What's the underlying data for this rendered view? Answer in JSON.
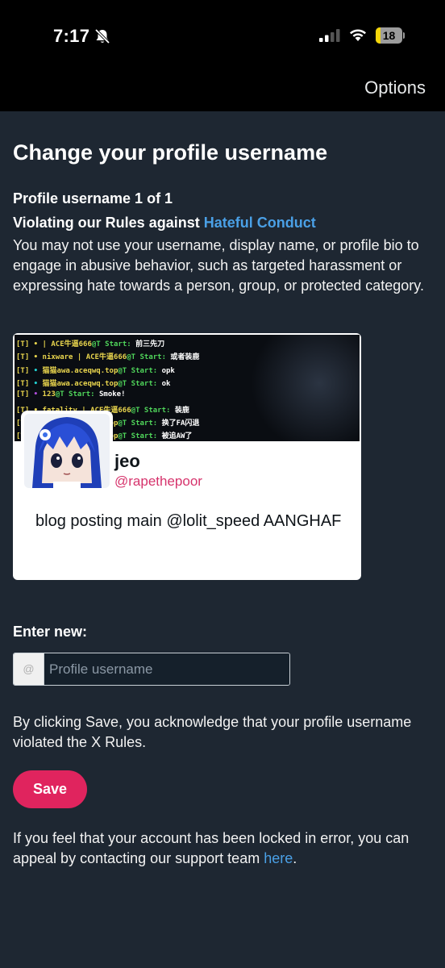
{
  "status_bar": {
    "time": "7:17",
    "battery_level": "18",
    "battery_fraction": 0.18,
    "icons": [
      "bell-slash-icon",
      "signal-icon",
      "wifi-icon",
      "battery-icon"
    ]
  },
  "nav": {
    "options_label": "Options"
  },
  "page": {
    "title": "Change your profile username",
    "subtitle": "Profile username 1 of 1",
    "violation_prefix": "Violating our Rules against",
    "violation_link": "Hateful Conduct",
    "description": "You may not use your username, display name, or profile bio to engage in abusive behavior, such as targeted harassment or expressing hate towards a person, group, or protected category."
  },
  "profile_card": {
    "banner_lines": [
      {
        "tag": "[T]",
        "dot": "•",
        "name": " | ACE牛逼666",
        "start": "@T Start:",
        "msg": " 前三先刀",
        "dot_color": "#e8d44d"
      },
      {
        "tag": "[T]",
        "dot": "•",
        "name": " nixware | ACE牛逼666",
        "start": "@T Start:",
        "msg": " 或者装鹿",
        "dot_color": "#e8d44d"
      },
      {
        "tag": "[T]",
        "dot": "•",
        "name": " 猫猫awa.aceqwq.top",
        "start": "@T Start:",
        "msg": " opk",
        "dot_color": "#22d3d3"
      },
      {
        "tag": "[T]",
        "dot": "•",
        "name": " 猫猫awa.aceqwq.top",
        "start": "@T Start:",
        "msg": " ok",
        "dot_color": "#22d3d3"
      },
      {
        "tag": "[T]",
        "dot": "•",
        "name": " 123",
        "start": "@T Start:",
        "msg": " Smoke!",
        "dot_color": "#b04ddb"
      },
      {
        "tag": "[T]",
        "dot": "•",
        "name": " fatality | ACE牛逼666",
        "start": "@T Start:",
        "msg": " 装鹿",
        "dot_color": "#e8d44d"
      },
      {
        "tag": "[T]",
        "dot": "•",
        "name": " 猫猫awa.aceqwq.top",
        "start": "@T Start:",
        "msg": " 换了FA闪退",
        "dot_color": "#22d3d3"
      },
      {
        "tag": "[T]",
        "dot": "•",
        "name": " 猫猫awa.aceqwq.top",
        "start": "@T Start:",
        "msg": " 被追AW了",
        "dot_color": "#22d3d3"
      }
    ],
    "display_name": "jeo",
    "handle": "@rapethepoor",
    "bio": "blog posting main @lolit_speed AANGHAF"
  },
  "form": {
    "enter_label": "Enter new:",
    "at_symbol": "@",
    "placeholder": "Profile username",
    "value": "",
    "acknowledge_text": "By clicking Save, you acknowledge that your profile username violated the X Rules.",
    "save_label": "Save"
  },
  "footer": {
    "appeal_prefix": "If you feel that your account has been locked in error, you can appeal by contacting our support team ",
    "appeal_link": "here",
    "appeal_suffix": "."
  },
  "colors": {
    "background": "#1e2732",
    "link": "#4aa0e6",
    "save_button": "#e0245e",
    "handle": "#d6336c"
  }
}
